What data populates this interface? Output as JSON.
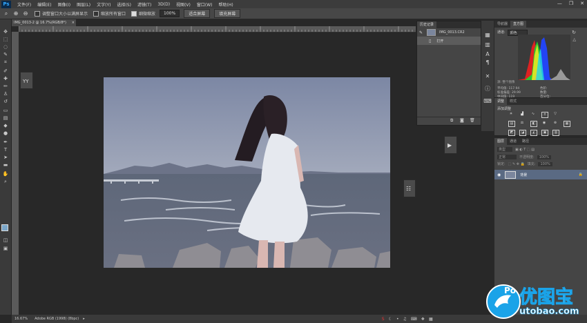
{
  "app": {
    "logo": "Ps"
  },
  "menu": {
    "items": [
      "文件(F)",
      "编辑(E)",
      "图像(I)",
      "图层(L)",
      "文字(Y)",
      "选择(S)",
      "滤镜(T)",
      "3D(D)",
      "视图(V)",
      "窗口(W)",
      "帮助(H)"
    ]
  },
  "window_controls": {
    "minimize": "—",
    "restore": "❐",
    "close": "✕"
  },
  "options": {
    "resize_windows_label": "调整窗口大小以满屏显示",
    "zoom_all_label": "缩放所有窗口",
    "scrubby_zoom_label": "细微缩放",
    "zoom_value": "100%",
    "fit_screen_label": "适合屏幕",
    "fill_screen_label": "填充屏幕"
  },
  "document": {
    "tab_title": "IMG_0013-2 @ 16.7%(RGB/8*)",
    "close": "×"
  },
  "float_panels": {
    "yy_label": "YY"
  },
  "history": {
    "tab_label": "历史记录",
    "snapshot_name": "IMG_0013.CR2",
    "step_label": "打开"
  },
  "navigator": {
    "tab1": "导航器",
    "tab2": "直方图",
    "channel_label": "通道:",
    "channel_value": "颜色",
    "source_label": "源:",
    "source_value": "整个图像",
    "stats_left": [
      [
        "平均值:",
        "117.94"
      ],
      [
        "标准偏差:",
        "29.99"
      ],
      [
        "中间值:",
        "119"
      ],
      [
        "像素:",
        "224836"
      ]
    ],
    "stats_right": [
      [
        "色阶:",
        ""
      ],
      [
        "数量:",
        ""
      ],
      [
        "百分位:",
        ""
      ],
      [
        "高速缓存级别:",
        "4"
      ]
    ]
  },
  "adjustments": {
    "tab1": "调整",
    "tab2": "样式",
    "add_label": "添加调整"
  },
  "layers": {
    "tab1": "图层",
    "tab2": "通道",
    "tab3": "路径",
    "kind_label": "类型",
    "mode_label": "正常",
    "opacity_label": "不透明度:",
    "opacity_value": "100%",
    "lock_label": "锁定:",
    "fill_label": "填充:",
    "fill_value": "100%",
    "layer_name": "背景"
  },
  "status": {
    "zoom": "16.67%",
    "doc_info": "Adobe RGB (1998) (8bpc)"
  },
  "watermark": {
    "prefix": "Po",
    "title": "优图宝",
    "url": "utobao.com"
  }
}
